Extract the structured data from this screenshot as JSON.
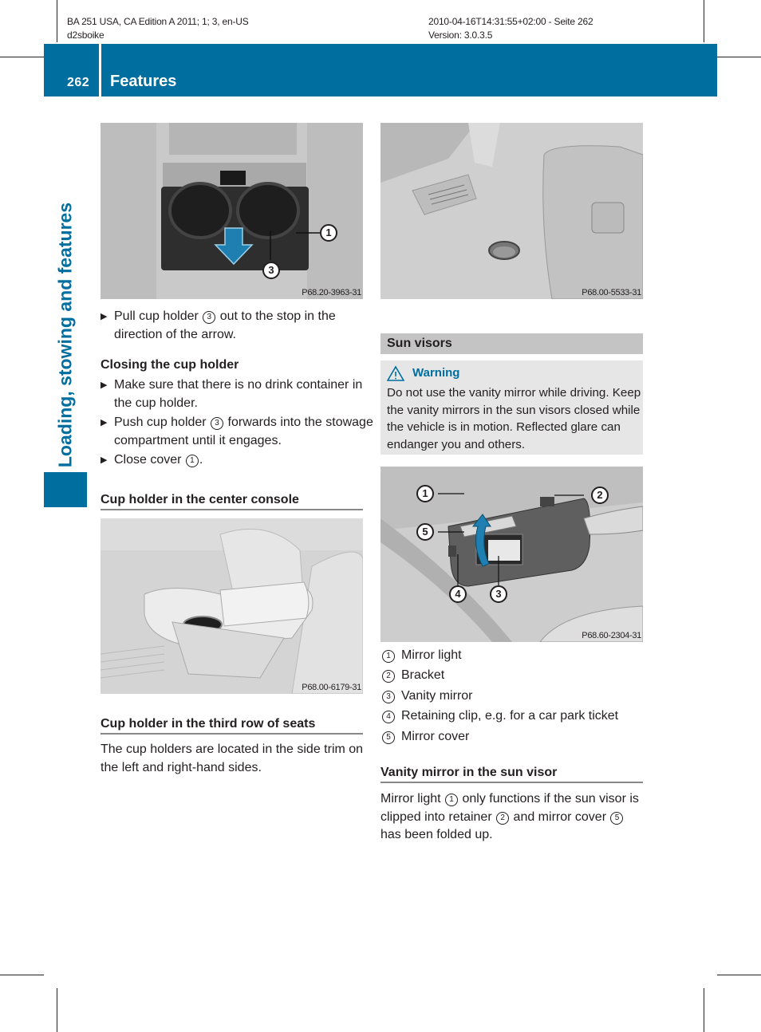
{
  "print_meta": {
    "left_line1": "BA 251 USA, CA Edition A 2011; 1; 3, en-US",
    "left_line2": "d2sboike",
    "right_line1": "2010-04-16T14:31:55+02:00 - Seite 262",
    "right_line2": "Version: 3.0.3.5"
  },
  "header": {
    "page_number": "262",
    "section": "Features"
  },
  "side_tab": {
    "title": "Loading, stowing and features"
  },
  "colors": {
    "brand_blue": "#006e9f",
    "section_grey": "#c4c4c4",
    "warning_bg": "#e6e6e6"
  },
  "left_column": {
    "figure1": {
      "code": "P68.20-3963-31",
      "callouts": [
        "1",
        "3"
      ]
    },
    "steps_open": [
      {
        "pre": "Pull cup holder ",
        "ref": "3",
        "post": " out to the stop in the direction of the arrow."
      }
    ],
    "closing_heading": "Closing the cup holder",
    "steps_close": [
      {
        "text": "Make sure that there is no drink container in the cup holder."
      },
      {
        "pre": "Push cup holder ",
        "ref": "3",
        "post": " forwards into the stowage compartment until it engages."
      },
      {
        "pre": "Close cover ",
        "ref": "1",
        "post": "."
      }
    ],
    "center_console_heading": "Cup holder in the center console",
    "figure2": {
      "code": "P68.00-6179-31"
    },
    "third_row_heading": "Cup holder in the third row of seats",
    "third_row_text": "The cup holders are located in the side trim on the left and right-hand sides."
  },
  "right_column": {
    "figure3": {
      "code": "P68.00-5533-31"
    },
    "sun_visors_heading": "Sun visors",
    "warning": {
      "icon": "warning-triangle-icon",
      "title": "Warning",
      "text": "Do not use the vanity mirror while driving. Keep the vanity mirrors in the sun visors closed while the vehicle is in motion. Reflected glare can endanger you and others."
    },
    "figure4": {
      "code": "P68.60-2304-31",
      "callouts": [
        "1",
        "2",
        "3",
        "4",
        "5"
      ]
    },
    "legend": [
      {
        "num": "1",
        "label": "Mirror light"
      },
      {
        "num": "2",
        "label": "Bracket"
      },
      {
        "num": "3",
        "label": "Vanity mirror"
      },
      {
        "num": "4",
        "label": "Retaining clip, e.g. for a car park ticket"
      },
      {
        "num": "5",
        "label": "Mirror cover"
      }
    ],
    "vanity_heading": "Vanity mirror in the sun visor",
    "vanity_text": {
      "p1": "Mirror light ",
      "r1": "1",
      "p2": " only functions if the sun visor is clipped into retainer ",
      "r2": "2",
      "p3": " and mirror cover ",
      "r3": "5",
      "p4": " has been folded up."
    }
  }
}
